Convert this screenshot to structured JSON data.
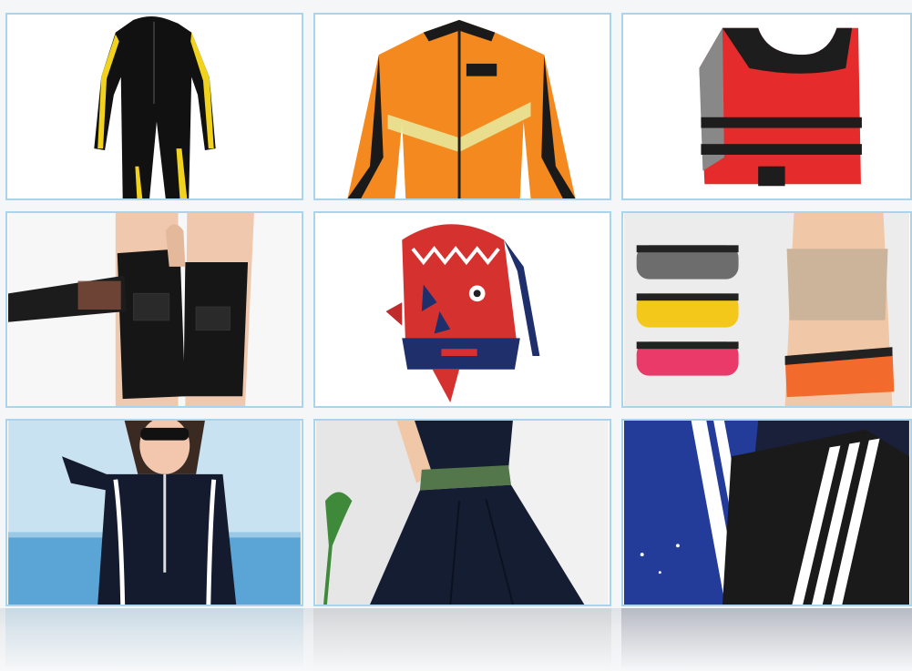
{
  "gallery": {
    "tiles": [
      {
        "icon": "wetsuit-black-yellow-icon"
      },
      {
        "icon": "orange-wetsuit-jacket-icon"
      },
      {
        "icon": "red-life-vest-icon"
      },
      {
        "icon": "knee-brace-icon"
      },
      {
        "icon": "dinosaur-backpack-icon"
      },
      {
        "icon": "running-waist-belt-icon"
      },
      {
        "icon": "rash-guard-swimsuit-icon"
      },
      {
        "icon": "swim-dress-icon"
      },
      {
        "icon": "striped-sport-bags-icon"
      }
    ],
    "colors": {
      "border": "#a9d4ec",
      "background": "#f4f6f8",
      "wetsuit_accent": "#f1d21d",
      "jacket_orange": "#f4891f",
      "vest_red": "#e52b2b",
      "backpack_red": "#d5322f",
      "belt_yellow": "#f3c81a",
      "belt_pink": "#ea3a6a",
      "belt_orange": "#f26a2c",
      "sea_blue": "#5aa4d6",
      "bag_blue": "#233c9a"
    }
  }
}
